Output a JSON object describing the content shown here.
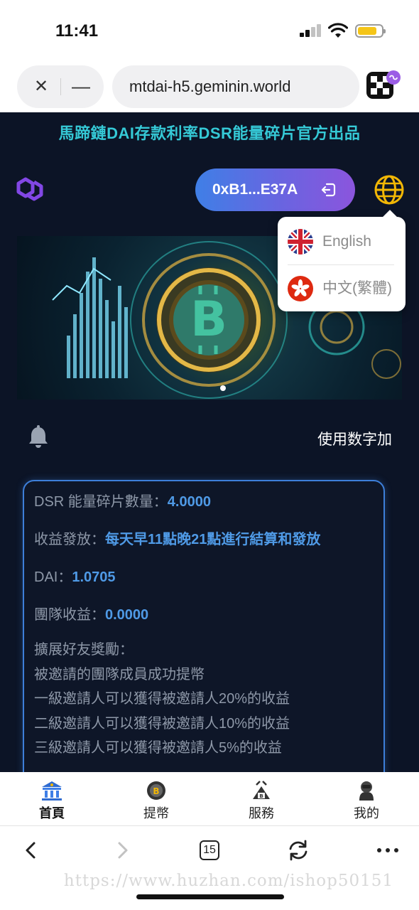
{
  "status_bar": {
    "time": "11:41",
    "battery_color": "#f5c518"
  },
  "browser": {
    "close_label": "✕",
    "minimize_label": "—",
    "url": "mtdai-h5.geminin.world",
    "tab_count": "15"
  },
  "page": {
    "headline": "馬蹄鏈DAI存款利率DSR能量碎片官方出品",
    "wallet_address": "0xB1...E37A",
    "notice_text": "使用数字加"
  },
  "language_menu": {
    "options": [
      {
        "label": "English",
        "flag": "uk-flag-icon"
      },
      {
        "label": "中文(繁體)",
        "flag": "hk-flag-icon"
      }
    ]
  },
  "info_card": {
    "rows": [
      {
        "label": "DSR 能量碎片數量：",
        "value": "4.0000"
      },
      {
        "label": "收益發放：",
        "value": "每天早11點晚21點進行結算和發放"
      },
      {
        "label": "DAI：",
        "value": "1.0705"
      },
      {
        "label": "團隊收益：",
        "value": "0.0000"
      }
    ],
    "promo_lines": [
      "擴展好友獎勵：",
      "被邀請的團隊成員成功提幣",
      "一級邀請人可以獲得被邀請人20%的收益",
      "二級邀請人可以獲得被邀請人10%的收益",
      "三級邀請人可以獲得被邀請人5%的收益"
    ]
  },
  "bottom_nav": [
    {
      "label": "首頁",
      "icon": "bank-icon",
      "active": true
    },
    {
      "label": "提幣",
      "icon": "coin-icon",
      "active": false
    },
    {
      "label": "服務",
      "icon": "service-icon",
      "active": false
    },
    {
      "label": "我的",
      "icon": "profile-icon",
      "active": false
    }
  ],
  "watermark": "https://www.huzhan.com/ishop50151",
  "colors": {
    "accent_teal": "#35c9d6",
    "value_blue": "#4f9ae6",
    "card_border": "#3d7fd9"
  }
}
